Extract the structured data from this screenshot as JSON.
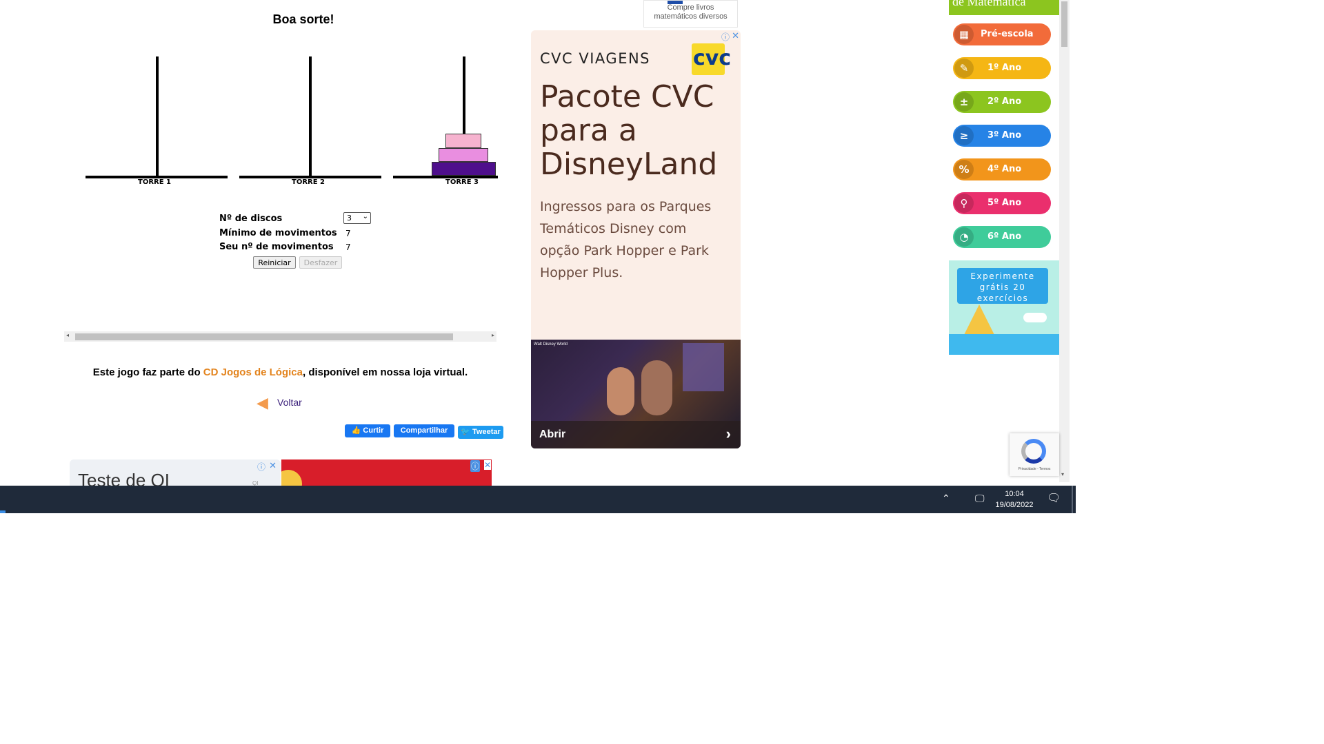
{
  "game": {
    "heading": "Boa sorte!",
    "towers": [
      "TORRE 1",
      "TORRE 2",
      "TORRE 3"
    ],
    "discs_label": "Nº de discos",
    "discs_value": "3",
    "min_moves_label": "Mínimo de movimentos",
    "min_moves_value": "7",
    "your_moves_label": "Seu nº de movimentos",
    "your_moves_value": "7",
    "restart_label": "Reiniciar",
    "undo_label": "Desfazer",
    "disc_colors": [
      "#f6b3cf",
      "#e98ee0",
      "#4e0f8c"
    ]
  },
  "promo": {
    "prefix": "Este jogo faz parte do ",
    "link": "CD Jogos de Lógica",
    "suffix": ", disponível em nossa loja virtual.",
    "back_label": "Voltar"
  },
  "social": {
    "like": "Curtir",
    "share": "Compartilhar",
    "tweet": "Tweetar"
  },
  "top_ad": {
    "line1": "Compre livros",
    "line2": "matemáticos diversos"
  },
  "cvc_ad": {
    "brand": "CVC VIAGENS",
    "logo_text": "cvc",
    "headline": "Pacote CVC para a DisneyLand",
    "body": "Ingressos para os Parques Temáticos Disney com opção Park Hopper e Park Hopper Plus.",
    "cta": "Abrir",
    "photo_logo": "Walt Disney World"
  },
  "bottom_ad": {
    "title": "Teste de QI",
    "sub": "QI"
  },
  "sidebar": {
    "header": "de Matemática",
    "grades": [
      {
        "label": "Pré-escola",
        "icon": "▦",
        "color": "#f26b3a"
      },
      {
        "label": "1º Ano",
        "icon": "✎",
        "color": "#f5b614"
      },
      {
        "label": "2º Ano",
        "icon": "±",
        "color": "#8cc51f"
      },
      {
        "label": "3º Ano",
        "icon": "≥",
        "color": "#2683e6"
      },
      {
        "label": "4º Ano",
        "icon": "%",
        "color": "#f2951b"
      },
      {
        "label": "5º Ano",
        "icon": "⚲",
        "color": "#ea2f6d"
      },
      {
        "label": "6º Ano",
        "icon": "◔",
        "color": "#3fcc9a"
      }
    ],
    "cta": "Experimente grátis 20 exercícios"
  },
  "recaptcha": {
    "text": "Privacidade - Termos"
  },
  "taskbar": {
    "time": "10:04",
    "date": "19/08/2022"
  }
}
